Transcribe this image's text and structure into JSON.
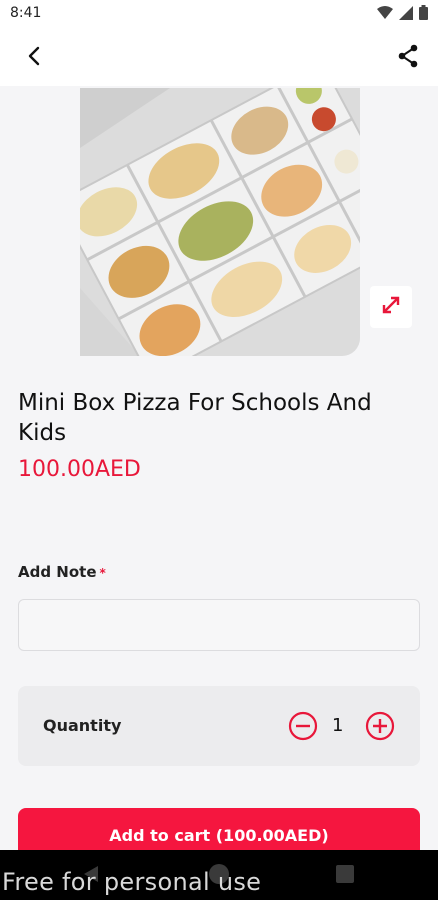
{
  "status_bar": {
    "time": "8:41",
    "icons": [
      "wifi-icon",
      "signal-icon",
      "battery-icon"
    ]
  },
  "app_bar": {
    "back_icon": "back-arrow-icon",
    "share_icon": "share-icon"
  },
  "product": {
    "title": "Mini Box Pizza For Schools And Kids",
    "price": "100.00AED",
    "image_icon": "expand-icon"
  },
  "note": {
    "label": "Add Note",
    "required_mark": "*",
    "value": "",
    "placeholder": ""
  },
  "quantity": {
    "label": "Quantity",
    "value": "1",
    "minus_icon": "minus-circle-icon",
    "plus_icon": "plus-circle-icon"
  },
  "cart": {
    "button_label": "Add to cart (100.00AED)"
  },
  "watermark": "Free for personal use",
  "colors": {
    "accent": "#e8173a",
    "button": "#f5163f",
    "background": "#f5f5f7",
    "card": "#ececee"
  }
}
